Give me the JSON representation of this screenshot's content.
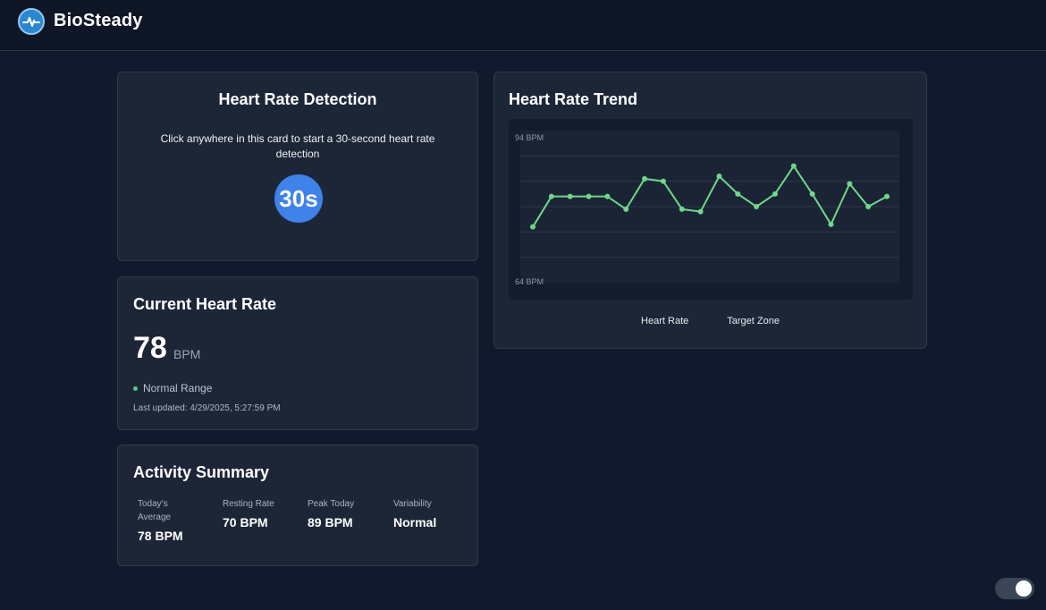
{
  "app": {
    "brand": "BioSteady"
  },
  "detection": {
    "title": "Heart Rate Detection",
    "instruction": "Click anywhere in this card to start a 30-second heart rate detection",
    "timer": "30s"
  },
  "current": {
    "title": "Current Heart Rate",
    "value": "78",
    "unit": "BPM",
    "status": "Normal Range",
    "updated": "Last updated: 4/29/2025, 5:27:59 PM"
  },
  "activity": {
    "title": "Activity Summary",
    "stats": [
      {
        "label": "Today's Average",
        "value": "78 BPM"
      },
      {
        "label": "Resting Rate",
        "value": "70 BPM"
      },
      {
        "label": "Peak Today",
        "value": "89 BPM"
      },
      {
        "label": "Variability",
        "value": "Normal"
      }
    ]
  },
  "trend": {
    "title": "Heart Rate Trend",
    "legend": [
      "Heart Rate",
      "Target Zone"
    ]
  },
  "chart_data": {
    "type": "line",
    "title": "Heart Rate Trend",
    "ylim": [
      64,
      94
    ],
    "ytick_labels": [
      "94 BPM",
      "64 BPM"
    ],
    "grid": true,
    "legend_placement": "bottom",
    "series": [
      {
        "name": "Heart Rate",
        "color": "#6fd68a",
        "values": [
          75,
          81,
          81,
          81,
          81,
          78.5,
          84.5,
          84,
          78.5,
          78,
          85,
          81.5,
          79,
          81.5,
          87,
          81.5,
          75.5,
          83.5,
          79,
          81
        ]
      }
    ]
  },
  "colors": {
    "accent": "#3e82ea",
    "line": "#6fd68a",
    "status": "#4fcf82"
  }
}
